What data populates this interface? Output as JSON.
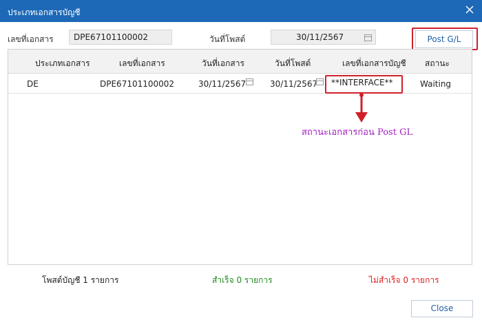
{
  "window": {
    "title": "ประเภทเอกสารบัญชี"
  },
  "form": {
    "doc_no_label": "เลขที่เอกสาร",
    "doc_no_value": "DPE67101100002",
    "post_date_label": "วันที่โพสต์",
    "post_date_value": "30/11/2567",
    "post_gl_button": "Post G/L"
  },
  "grid": {
    "columns": [
      "ประเภทเอกสาร",
      "เลขที่เอกสาร",
      "วันที่เอกสาร",
      "วันที่โพสต์",
      "เลขที่เอกสารบัญชี",
      "สถานะ"
    ],
    "rows": [
      {
        "doc_type": "DE",
        "doc_no": "DPE67101100002",
        "doc_date": "30/11/2567",
        "post_date": "30/11/2567",
        "gl_doc_no": "**INTERFACE**",
        "status": "Waiting"
      }
    ]
  },
  "annotation": {
    "text": "สถานะเอกสารก่อน Post GL",
    "color": "#a020c0",
    "arrow_color": "#d0202a"
  },
  "summary": {
    "posted": "โพสต์บัญชี 1 รายการ",
    "success": "สำเร็จ 0 รายการ",
    "failed": "ไม่สำเร็จ 0 รายการ",
    "success_color": "#1e8a1e",
    "failed_color": "#e02020"
  },
  "buttons": {
    "close": "Close"
  },
  "icons": [
    "close-icon",
    "calendar-icon"
  ]
}
